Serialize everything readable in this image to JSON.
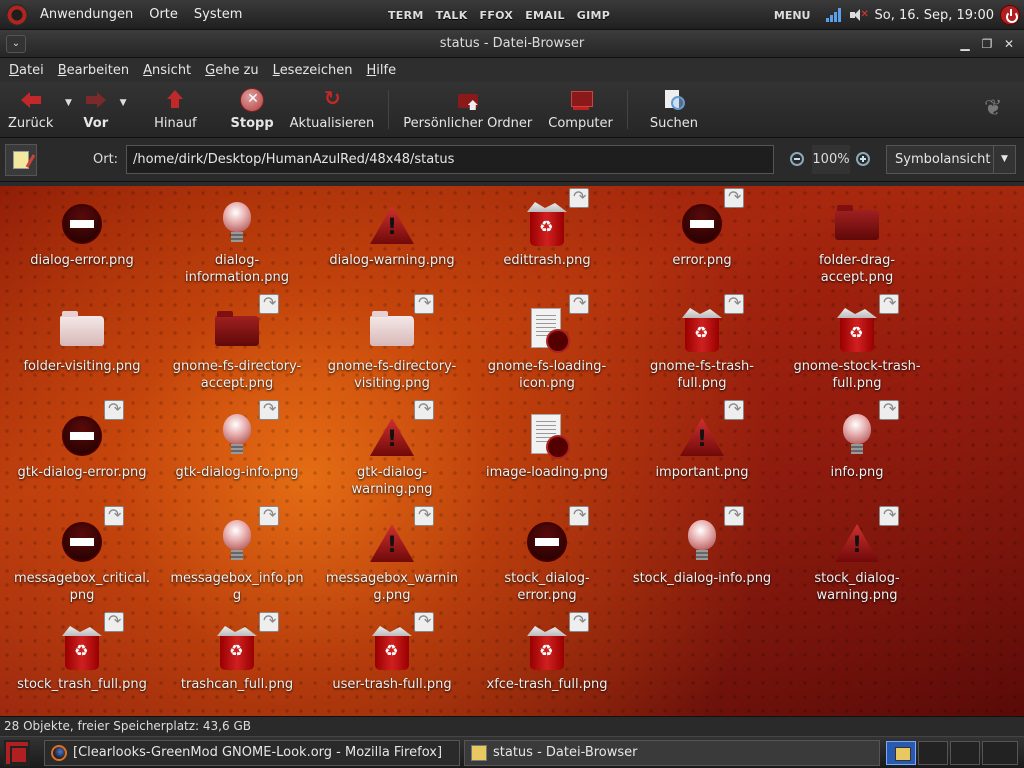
{
  "top_panel": {
    "menus": [
      "Anwendungen",
      "Orte",
      "System"
    ],
    "launchers": [
      "TERM",
      "TALK",
      "FFOX",
      "EMAIL",
      "GIMP"
    ],
    "menu_label": "MENU",
    "clock": "So, 16. Sep, 19:00"
  },
  "window": {
    "title": "status - Datei-Browser",
    "menubar": [
      {
        "first": "D",
        "rest": "atei"
      },
      {
        "first": "B",
        "rest": "earbeiten"
      },
      {
        "first": "A",
        "rest": "nsicht"
      },
      {
        "first": "G",
        "rest": "ehe zu"
      },
      {
        "first": "L",
        "rest": "esezeichen"
      },
      {
        "first": "H",
        "rest": "ilfe"
      }
    ],
    "toolbar": {
      "back": "Zurück",
      "forward": "Vor",
      "up": "Hinauf",
      "stop": "Stopp",
      "reload": "Aktualisieren",
      "home": "Persönlicher Ordner",
      "computer": "Computer",
      "search": "Suchen"
    },
    "location": {
      "label": "Ort:",
      "path": "/home/dirk/Desktop/HumanAzulRed/48x48/status",
      "zoom": "100%",
      "view": "Symbolansicht"
    },
    "files": [
      {
        "name": "dialog-error.png",
        "icon": "error-icon",
        "link": false
      },
      {
        "name": "dialog-information.png",
        "icon": "bulb-icon",
        "link": false
      },
      {
        "name": "dialog-warning.png",
        "icon": "warning-icon",
        "link": false
      },
      {
        "name": "edittrash.png",
        "icon": "trash-icon",
        "link": true
      },
      {
        "name": "error.png",
        "icon": "error-icon",
        "link": true
      },
      {
        "name": "folder-drag-accept.png",
        "icon": "folder-red-icon",
        "link": false
      },
      {
        "name": "folder-visiting.png",
        "icon": "folder-icon",
        "link": false
      },
      {
        "name": "gnome-fs-directory-accept.png",
        "icon": "folder-red-icon",
        "link": true
      },
      {
        "name": "gnome-fs-directory-visiting.png",
        "icon": "folder-icon",
        "link": true
      },
      {
        "name": "gnome-fs-loading-icon.png",
        "icon": "document-icon",
        "link": true
      },
      {
        "name": "gnome-fs-trash-full.png",
        "icon": "trash-icon",
        "link": true
      },
      {
        "name": "gnome-stock-trash-full.png",
        "icon": "trash-icon",
        "link": true
      },
      {
        "name": "gtk-dialog-error.png",
        "icon": "error-icon",
        "link": true
      },
      {
        "name": "gtk-dialog-info.png",
        "icon": "bulb-icon",
        "link": true
      },
      {
        "name": "gtk-dialog-warning.png",
        "icon": "warning-icon",
        "link": true
      },
      {
        "name": "image-loading.png",
        "icon": "document-icon",
        "link": false
      },
      {
        "name": "important.png",
        "icon": "warning-icon",
        "link": true
      },
      {
        "name": "info.png",
        "icon": "bulb-icon",
        "link": true
      },
      {
        "name": "messagebox_critical.png",
        "icon": "error-icon",
        "link": true
      },
      {
        "name": "messagebox_info.png",
        "icon": "bulb-icon",
        "link": true
      },
      {
        "name": "messagebox_warning.png",
        "icon": "warning-icon",
        "link": true
      },
      {
        "name": "stock_dialog-error.png",
        "icon": "error-icon",
        "link": true
      },
      {
        "name": "stock_dialog-info.png",
        "icon": "bulb-icon",
        "link": true
      },
      {
        "name": "stock_dialog-warning.png",
        "icon": "warning-icon",
        "link": true
      },
      {
        "name": "stock_trash_full.png",
        "icon": "trash-icon",
        "link": true
      },
      {
        "name": "trashcan_full.png",
        "icon": "trash-icon",
        "link": true
      },
      {
        "name": "user-trash-full.png",
        "icon": "trash-icon",
        "link": true
      },
      {
        "name": "xfce-trash_full.png",
        "icon": "trash-icon",
        "link": true
      }
    ],
    "status": "28 Objekte, freier Speicherplatz: 43,6 GB"
  },
  "taskbar": {
    "tasks": [
      {
        "label": "[Clearlooks-GreenMod  GNOME-Look.org  -  Mozilla  Firefox]",
        "icon": "firefox-icon"
      },
      {
        "label": "status  -  Datei-Browser",
        "icon": "file-manager-icon"
      }
    ]
  }
}
